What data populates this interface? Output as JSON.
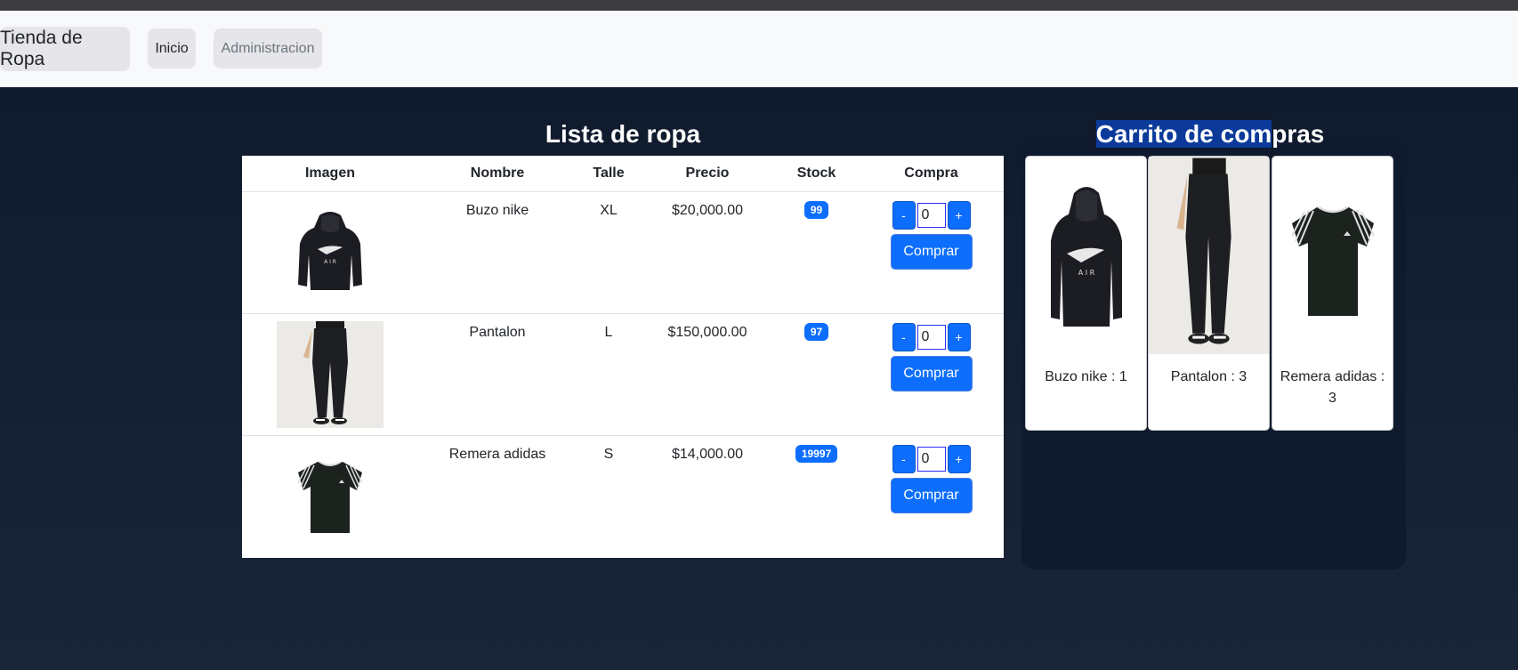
{
  "navbar": {
    "brand": "Tienda de Ropa",
    "links": [
      "Inicio",
      "Administracion"
    ]
  },
  "lista": {
    "title": "Lista de ropa",
    "headers": [
      "Imagen",
      "Nombre",
      "Talle",
      "Precio",
      "Stock",
      "Compra"
    ],
    "rows": [
      {
        "nombre": "Buzo nike",
        "talle": "XL",
        "precio": "$20,000.00",
        "stock": "99",
        "qty": "0",
        "img": "hoodie-image"
      },
      {
        "nombre": "Pantalon",
        "talle": "L",
        "precio": "$150,000.00",
        "stock": "97",
        "qty": "0",
        "img": "pants-image"
      },
      {
        "nombre": "Remera adidas",
        "talle": "S",
        "precio": "$14,000.00",
        "stock": "19997",
        "qty": "0",
        "img": "tshirt-image"
      }
    ],
    "minus": "-",
    "plus": "+",
    "buy_label": "Comprar"
  },
  "carrito": {
    "title_highlighted": "Carrito de com",
    "title_rest": "pras",
    "items": [
      {
        "label": "Buzo nike : 1",
        "img": "hoodie-image"
      },
      {
        "label": "Pantalon : 3",
        "img": "pants-image"
      },
      {
        "label": "Remera adidas : 3",
        "img": "tshirt-image"
      }
    ]
  },
  "colors": {
    "primary": "#0d6efd",
    "background": "#111b2c",
    "navbar": "#f8f9fa"
  }
}
